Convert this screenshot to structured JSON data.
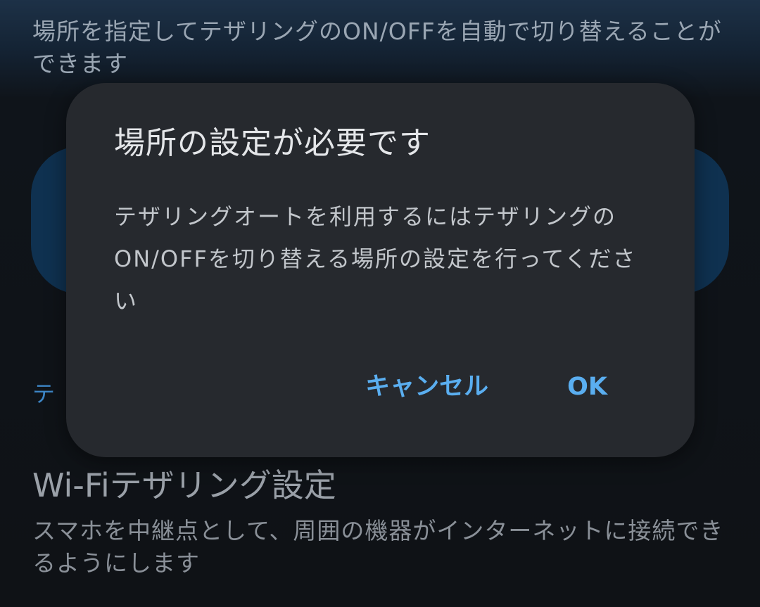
{
  "background": {
    "description": "場所を指定してテザリングのON/OFFを自動で切り替えることができます",
    "section_label": "テ",
    "wifi_title": "Wi-Fiテザリング設定",
    "wifi_subtitle": "スマホを中継点として、周囲の機器がインターネットに接続できるようにします"
  },
  "dialog": {
    "title": "場所の設定が必要です",
    "message": "テザリングオートを利用するにはテザリングのON/OFFを切り替える場所の設定を行ってください",
    "cancel_label": "キャンセル",
    "ok_label": "OK"
  },
  "colors": {
    "accent": "#5aaef0",
    "dialog_bg": "#26292e"
  }
}
